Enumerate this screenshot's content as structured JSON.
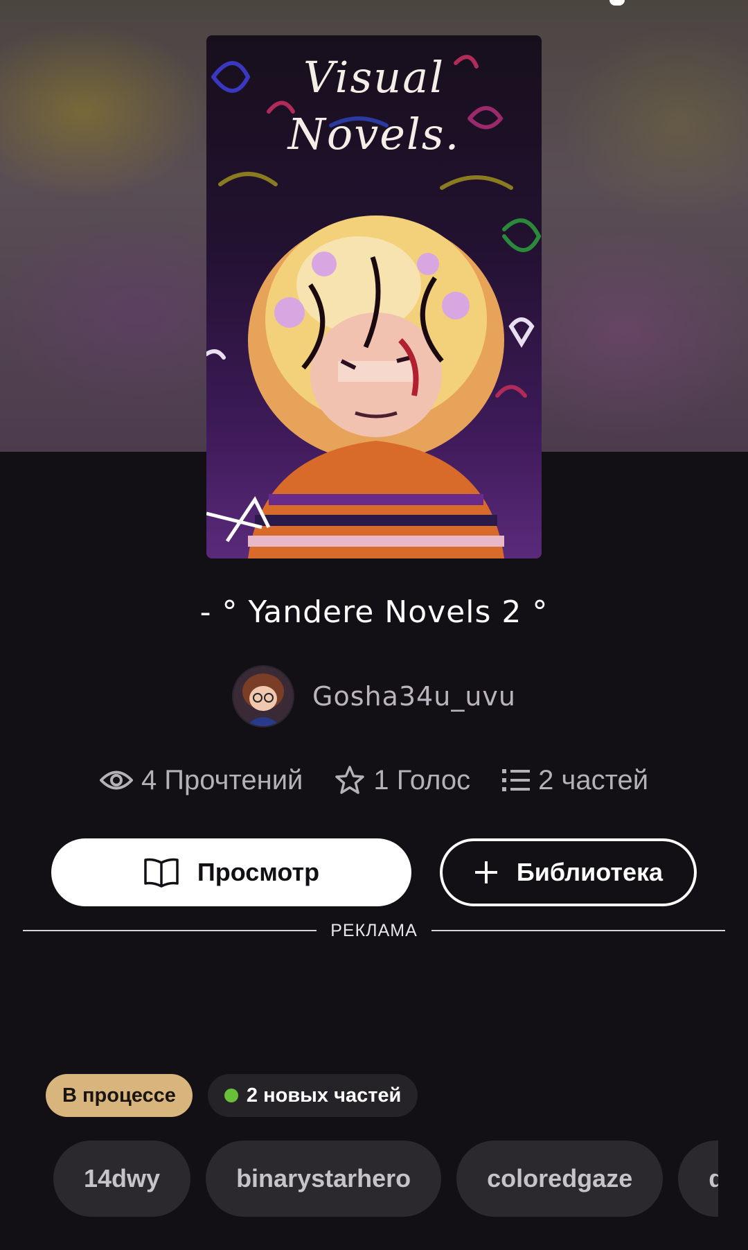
{
  "book": {
    "cover_title_line1": "Visual",
    "cover_title_line2": "Novels.",
    "title": "- ° Yandere Novels 2 °"
  },
  "author": {
    "name": "Gosha34u_uvu"
  },
  "stats": {
    "reads": "4 Прочтений",
    "votes": "1 Голос",
    "parts": "2 частей"
  },
  "actions": {
    "read_label": "Просмотр",
    "library_label": "Библиотека"
  },
  "ad": {
    "label": "РЕКЛАМА"
  },
  "badges": {
    "status": "В процессе",
    "new_parts": "2 новых частей"
  },
  "tags": [
    "14dwy",
    "binarystarhero",
    "coloredgaze",
    "d"
  ],
  "icons": {
    "reads": "eye-icon",
    "votes": "star-icon",
    "parts": "list-icon",
    "read_button": "book-open-icon",
    "library_button": "plus-icon"
  },
  "colors": {
    "background": "#121014",
    "status_badge": "#d9b57e",
    "new_parts_dot": "#6abf3a"
  }
}
